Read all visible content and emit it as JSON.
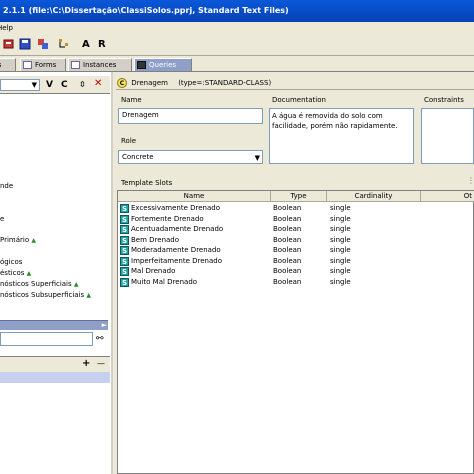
{
  "window": {
    "title": "2.1.1    (file:\\C:\\Dissertação\\ClassiSolos.pprj, Standard Text Files)"
  },
  "menubar": {
    "help": "Help"
  },
  "toolbar": {
    "a_label": "A",
    "r_label": "R"
  },
  "tabs": [
    {
      "label": "ts",
      "icon": "slots-icon"
    },
    {
      "label": "Forms",
      "icon": "forms-icon"
    },
    {
      "label": "Instances",
      "icon": "instances-icon"
    },
    {
      "label": "Queries",
      "icon": "queries-icon"
    }
  ],
  "left": {
    "v_label": "V",
    "c_label": "C",
    "items": [
      {
        "text": "nde",
        "star": false
      },
      {
        "text": "e",
        "star": false
      },
      {
        "text": "Primário",
        "star": true
      },
      {
        "text": "ógicos",
        "star": false
      },
      {
        "text": "ésticos",
        "star": true
      },
      {
        "text": "nósticos Superficiais",
        "star": true
      },
      {
        "text": "nósticos Subsuperficiais",
        "star": true
      }
    ],
    "plus_label": "+"
  },
  "class_header": {
    "name": "Drenagem",
    "type": "(type=:STANDARD-CLASS)"
  },
  "form": {
    "name_label": "Name",
    "name_value": "Drenagem",
    "doc_label": "Documentation",
    "doc_value": "A água é removida do solo com facilidade, porém não rapidamente.",
    "constraints_label": "Constraints",
    "role_label": "Role",
    "role_value": "Concrete",
    "template_slots_label": "Template Slots"
  },
  "slots_table": {
    "headers": [
      "Name",
      "Type",
      "Cardinality",
      "Ot"
    ],
    "rows": [
      {
        "name": "Excessivamente Drenado",
        "type": "Boolean",
        "card": "single"
      },
      {
        "name": "Fortemente Drenado",
        "type": "Boolean",
        "card": "single"
      },
      {
        "name": "Acentuadamente Drenado",
        "type": "Boolean",
        "card": "single"
      },
      {
        "name": "Bem Drenado",
        "type": "Boolean",
        "card": "single"
      },
      {
        "name": "Moderadamente Drenado",
        "type": "Boolean",
        "card": "single"
      },
      {
        "name": "Imperfeitamente Drenado",
        "type": "Boolean",
        "card": "single"
      },
      {
        "name": "Mal Drenado",
        "type": "Boolean",
        "card": "single"
      },
      {
        "name": "Muito Mal Drenado",
        "type": "Boolean",
        "card": "single"
      }
    ],
    "slot_icon_letter": "S"
  },
  "colors": {
    "titlebar": "#0a58d8",
    "tab_active": "#8ea0c8",
    "slot_icon": "#20a0a0"
  }
}
